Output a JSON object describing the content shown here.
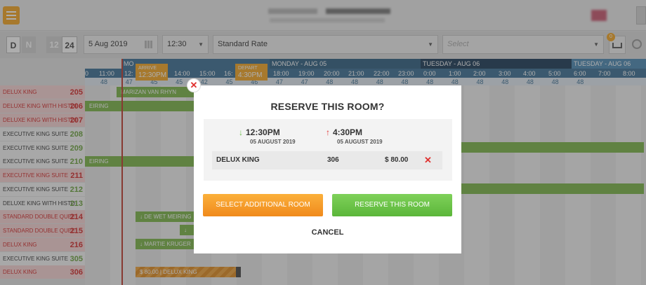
{
  "toolbar": {
    "view_d": "D",
    "view_n": "N",
    "hours_12": "12",
    "hours_24": "24",
    "date": "5 Aug 2019",
    "time": "12:30",
    "rate": "Standard Rate",
    "select_placeholder": "Select",
    "badge_count": "0"
  },
  "timeline": {
    "days": [
      {
        "label": "MO",
        "color": "#3b6f94"
      },
      {
        "label": "MONDAY - AUG 05",
        "color": "#2f5f82"
      },
      {
        "label": "TUESDAY - AUG 06",
        "color": "#1a3a57"
      },
      {
        "label": "TUESDAY - AUG 06",
        "color": "#4a88b4"
      }
    ],
    "hours": [
      "0",
      "11:00",
      "12:",
      "14:00",
      "15:00",
      "16:",
      "18:00",
      "19:00",
      "20:00",
      "21:00",
      "22:00",
      "23:00",
      "0:00",
      "1:00",
      "2:00",
      "3:00",
      "4:00",
      "5:00",
      "6:00",
      "7:00",
      "8:00"
    ],
    "counts": [
      "48",
      "47",
      "45",
      "45",
      "42",
      "45",
      "46",
      "47",
      "47",
      "48",
      "48",
      "48",
      "48",
      "48",
      "48",
      "48",
      "48",
      "48",
      "48",
      "48"
    ],
    "arrive_flag": {
      "label": "ARRIVE",
      "time": "12:30PM"
    },
    "depart_flag": {
      "label": "DEPART",
      "time": "4:30PM"
    },
    "arrive_fragment": "S"
  },
  "rooms": [
    {
      "name": "DELUX KING",
      "number": "205",
      "status": "red"
    },
    {
      "name": "DELUXE KING WITH HISTOI",
      "number": "206",
      "status": "red"
    },
    {
      "name": "DELUXE KING WITH HISTOI",
      "number": "207",
      "status": "red"
    },
    {
      "name": "EXECUTIVE KING SUITE",
      "number": "208",
      "status": "white"
    },
    {
      "name": "EXECUTIVE KING SUITE",
      "number": "209",
      "status": "white"
    },
    {
      "name": "EXECUTIVE KING SUITE",
      "number": "210",
      "status": "white"
    },
    {
      "name": "EXECUTIVE KING SUITE",
      "number": "211",
      "status": "red"
    },
    {
      "name": "EXECUTIVE KING SUITE",
      "number": "212",
      "status": "white"
    },
    {
      "name": "DELUXE KING WITH HISTO",
      "number": "213",
      "status": "white"
    },
    {
      "name": "STANDARD DOUBLE QUEE",
      "number": "214",
      "status": "red"
    },
    {
      "name": "STANDARD DOUBLE QUEE",
      "number": "215",
      "status": "red"
    },
    {
      "name": "DELUX KING",
      "number": "216",
      "status": "red"
    },
    {
      "name": "EXECUTIVE KING SUITE",
      "number": "305",
      "status": "white"
    },
    {
      "name": "DELUX KING",
      "number": "306",
      "status": "red"
    }
  ],
  "bookings": {
    "b205": "MARIZAN VAN RHYN",
    "b206": "EIRING",
    "b210": "EIRING",
    "b214": "DE WET MEIRING",
    "b216": "MARTIE KRUGER",
    "b306": "$ 80.00 | DELUX KING"
  },
  "modal": {
    "title": "RESERVE THIS ROOM?",
    "arrive_time": "12:30PM",
    "arrive_date": "05 AUGUST 2019",
    "depart_time": "4:30PM",
    "depart_date": "05 AUGUST 2019",
    "room_type": "DELUX KING",
    "room_number": "306",
    "price": "$ 80.00",
    "select_additional": "SELECT ADDITIONAL ROOM",
    "reserve": "RESERVE THIS ROOM",
    "cancel": "CANCEL"
  },
  "colors": {
    "accent_orange": "#f5a623",
    "reserve_green": "#6cc04a",
    "remove_red": "#e0312f",
    "booking_green": "#7ab648"
  }
}
